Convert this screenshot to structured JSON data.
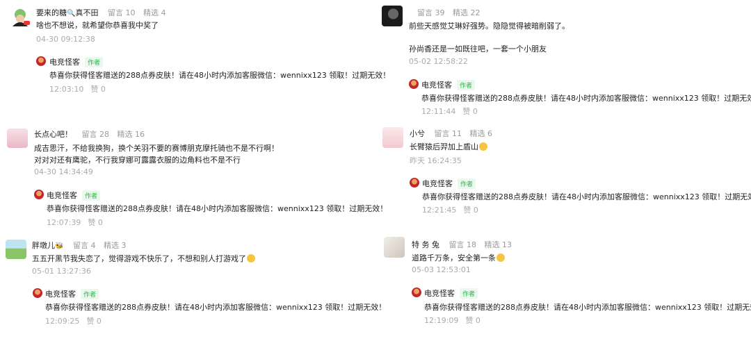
{
  "author_badge": "作者",
  "reply_name": "电竞怪客",
  "reply_text": "恭喜你获得怪客赠送的288点券皮肤！请在48小时内添加客服微信：wennixx123 领取！过期无效！",
  "like_label": "赞 0",
  "comments": [
    {
      "nick": "要来的糖",
      "nick_suffix": "真不田",
      "comments_count": "留言 10",
      "picks_count": "精选 4",
      "lines": [
        "啥也不想说，就希望你恭喜我中奖了"
      ],
      "time": "04-30 09:12:38",
      "reply_time": "12:03:10"
    },
    {
      "nick": "长点心吧！",
      "comments_count": "留言 28",
      "picks_count": "精选 16",
      "lines": [
        "成吉思汗，不给我换狗，换个关羽不要的赛博朋克摩托骑也不是不行啊！",
        "对对对还有鹰驼，不行我穿娜可露露衣服的边角料也不是不行"
      ],
      "time": "04-30 14:34:49",
      "reply_time": "12:07:39"
    },
    {
      "nick": "胖墩儿",
      "comments_count": "留言 4",
      "picks_count": "精选 3",
      "lines": [
        "五五开黑节我失恋了，觉得游戏不快乐了，不想和别人打游戏了"
      ],
      "time": "05-01 13:27:36",
      "reply_time": "12:09:25"
    },
    {
      "nick": "",
      "comments_count": "留言 39",
      "picks_count": "精选 22",
      "lines": [
        "前些天感觉艾琳好强势。隐隐觉得被暗削弱了。",
        "",
        "孙尚香还是一如既往吧，一套一个小朋友"
      ],
      "time": "05-02 12:58:22",
      "reply_time": "12:11:44"
    },
    {
      "nick": "小兮",
      "comments_count": "留言 11",
      "picks_count": "精选 6",
      "lines": [
        "长臂猿后羿加上盾山"
      ],
      "time": "昨天 16:24:35",
      "reply_time": "12:21:45"
    },
    {
      "nick": "特 务 兔",
      "comments_count": "留言 18",
      "picks_count": "精选 13",
      "lines": [
        "道路千万条，安全第一条"
      ],
      "time": "05-03 12:53:01",
      "reply_time": "12:19:09"
    }
  ]
}
